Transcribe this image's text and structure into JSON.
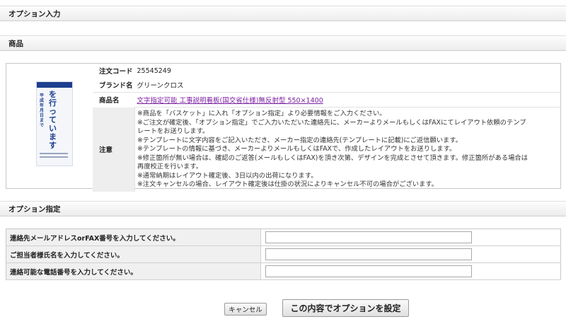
{
  "page": {
    "title": "オプション入力",
    "product_section": "商品",
    "option_section": "オプション指定"
  },
  "product": {
    "thumbnail": {
      "left_text": "平成年月日まで",
      "big_text": "を行っています"
    },
    "rows": {
      "order_code_label": "注文コード",
      "order_code": "25545249",
      "brand_label": "ブランド名",
      "brand": "グリーンクロス",
      "name_label": "商品名",
      "name": "文字指定可能 工事説明看板(国交省仕様)無反射型 550×1400",
      "notes_label": "注意"
    },
    "notes": [
      "※商品を「バスケット」に入れ「オプション指定」より必要情報をご入力ください。",
      "※ご注文が確定後、「オプション指定」でご入力いただいた連絡先に、メーカーよりメールもしくはFAXにてレイアウト依頼のテンプ",
      "レートをお送りします。",
      "※テンプレートに文字内容をご記入いただき、メーカー指定の連絡先(テンプレートに記載)にご返信願います。",
      "※テンプレートの情報に基づき、メーカーよりメールもしくはFAXで、作成したレイアウトをお送りします。",
      "※修正箇所が無い場合は、確認のご返答(メールもしくはFAX)を頂き次第、デザインを完成とさせて頂きます。修正箇所がある場合は",
      "再度校正を行います。",
      "※通常納期はレイアウト確定後、3日以内の出荷になります。",
      "※注文キャンセルの場合、レイアウト確定後は仕掛の状況によりキャンセル不可の場合がございます。"
    ]
  },
  "form": {
    "fields": [
      {
        "label": "連絡先メールアドレスorFAX番号を入力してください。",
        "value": ""
      },
      {
        "label": "ご担当者様氏名を入力してください。",
        "value": ""
      },
      {
        "label": "連絡可能な電話番号を入力してください。",
        "value": ""
      }
    ]
  },
  "buttons": {
    "cancel": "キャンセル",
    "submit": "この内容でオプションを設定"
  },
  "colors": {
    "link": "#7b1fa2",
    "thumbnail_accent": "#1d3f8f",
    "header_bar": "#ececec"
  }
}
